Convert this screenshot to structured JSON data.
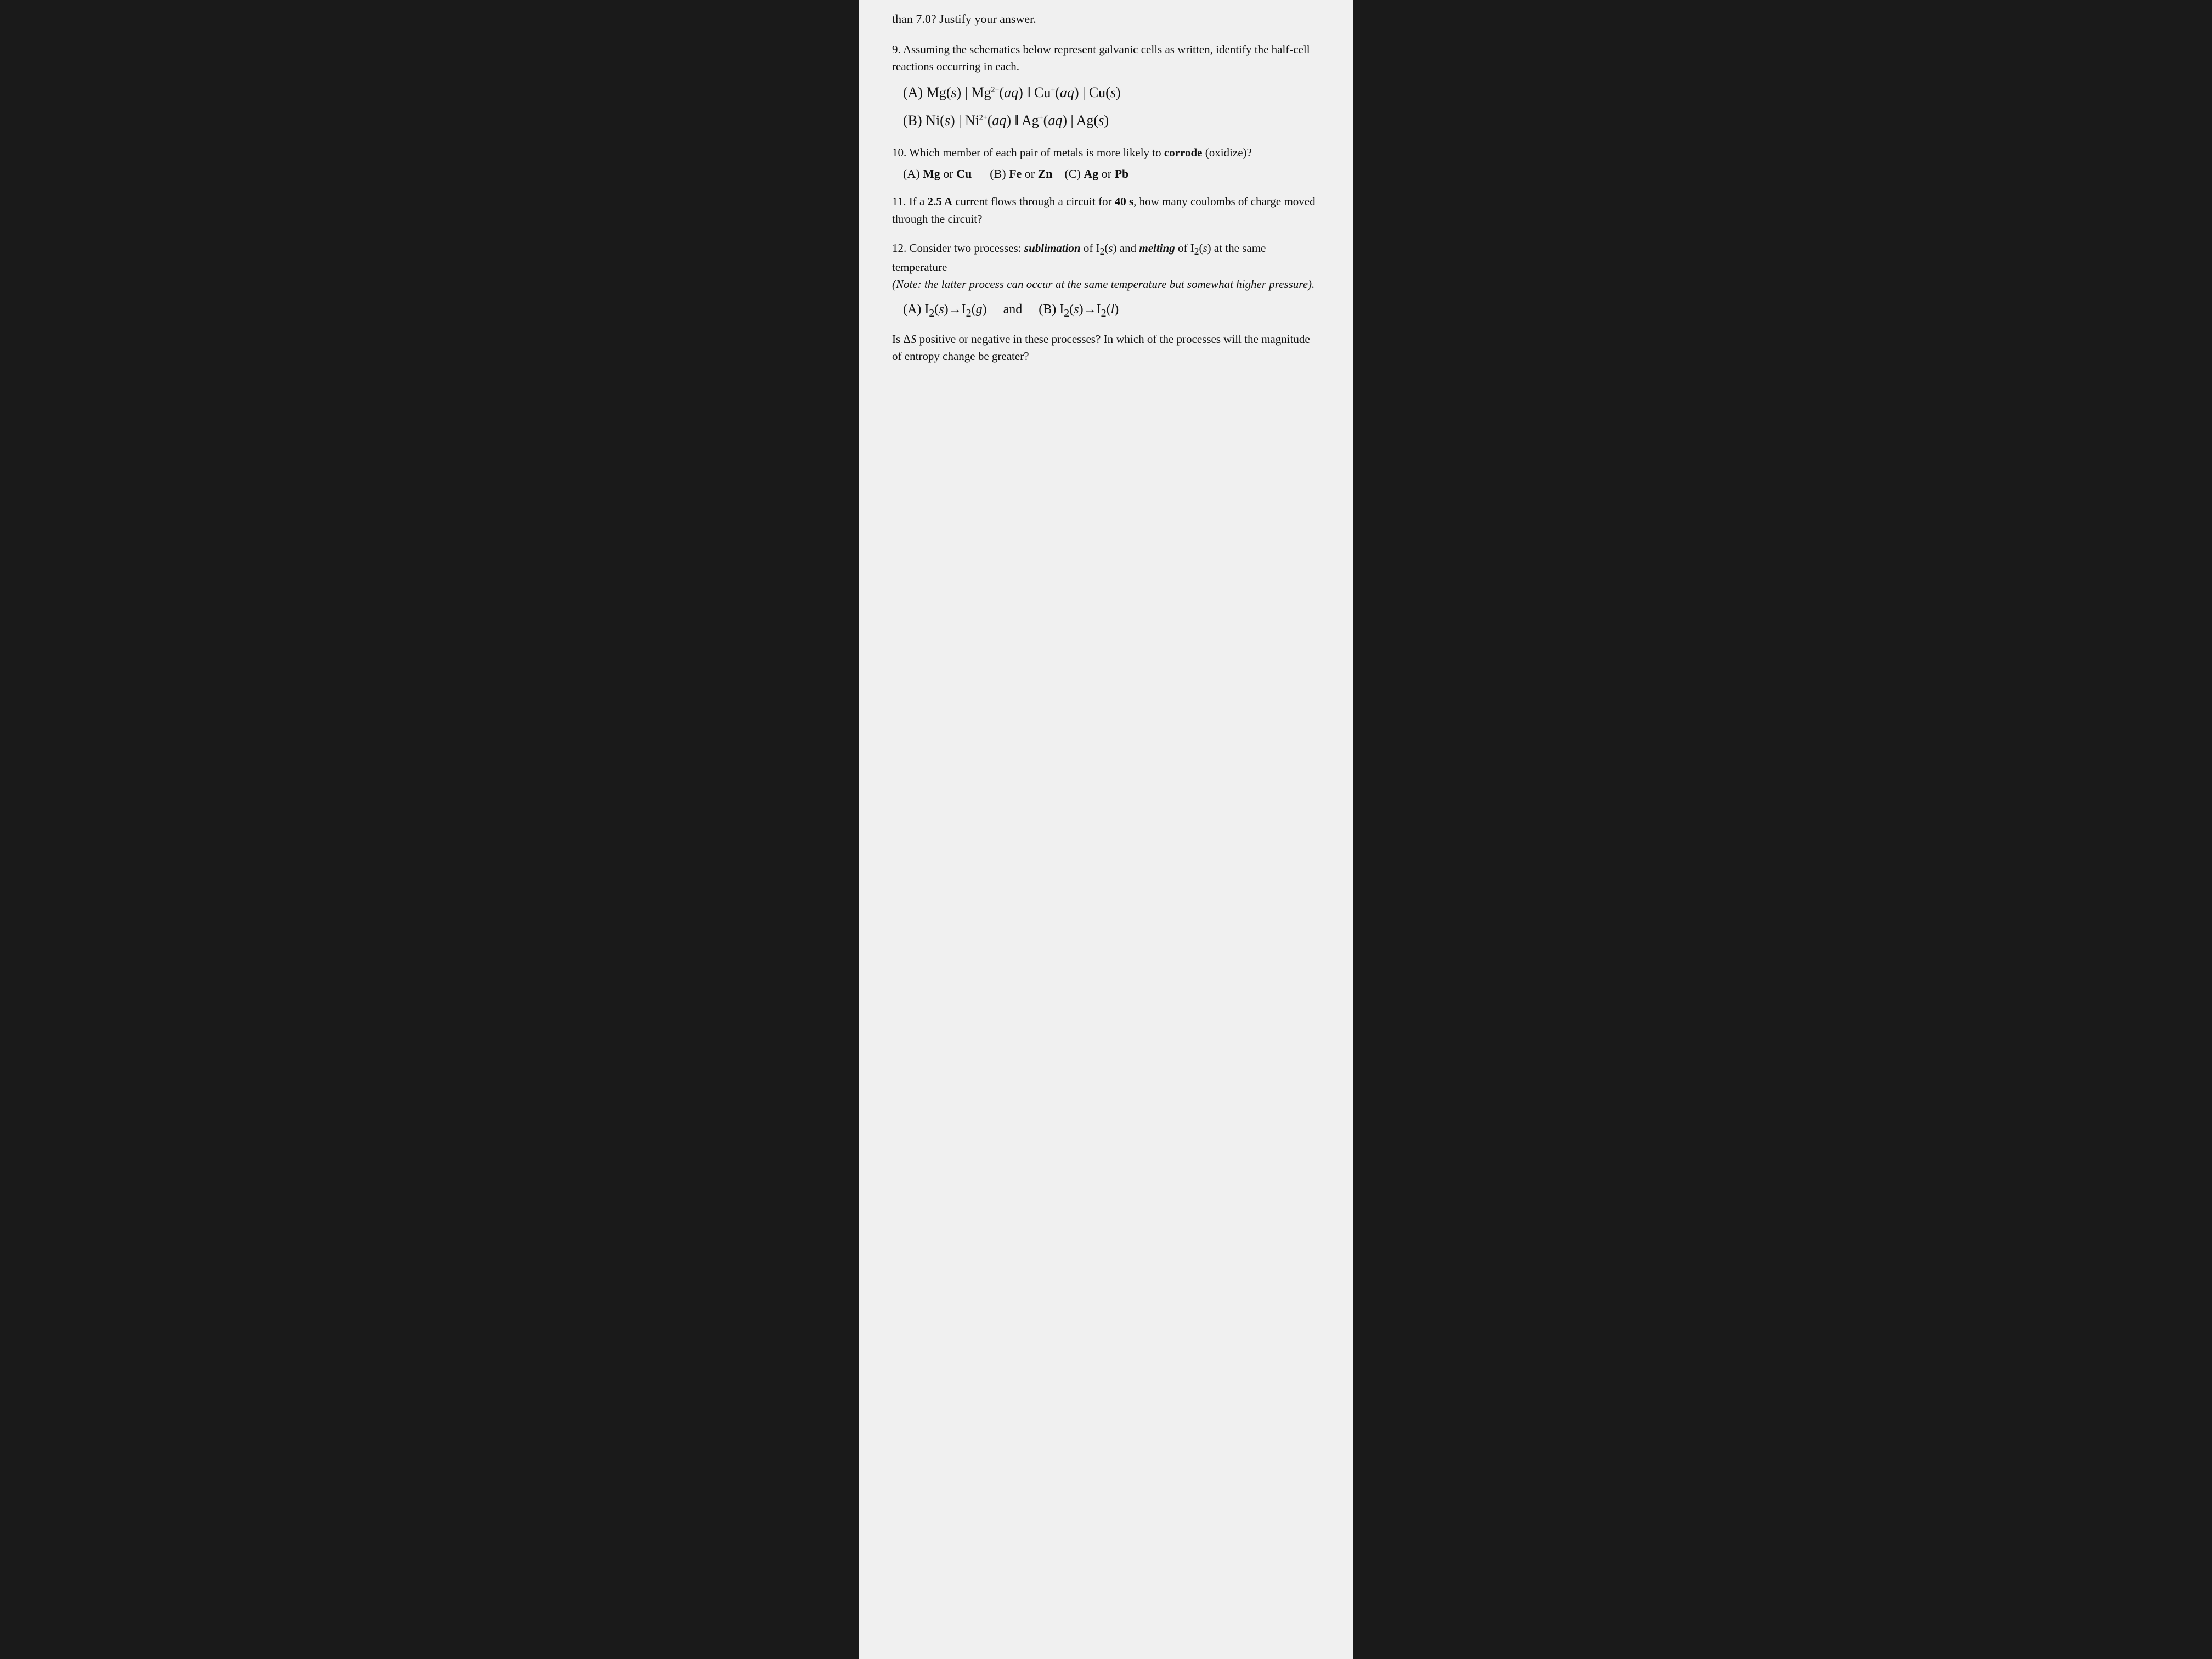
{
  "header": {
    "partial_text": "than 7.0? Justify your answer."
  },
  "questions": [
    {
      "id": "q9",
      "number": "9.",
      "text": "Assuming the schematics below represent galvanic cells as written, identify the half-cell reactions occurring in each.",
      "parts": [
        {
          "label": "(A)",
          "notation": "Mg(s) | Mg²⁺(aq) ‖ Cu⁺(aq) | Cu(s)"
        },
        {
          "label": "(B)",
          "notation": "Ni(s) | Ni²⁺(aq) ‖ Ag⁺(aq) | Ag(s)"
        }
      ]
    },
    {
      "id": "q10",
      "number": "10.",
      "text": "Which member of each pair of metals is more likely to corrode (oxidize)?",
      "options": "(A) Mg or Cu    (B) Fe or Zn   (C) Ag or Pb"
    },
    {
      "id": "q11",
      "number": "11.",
      "text": "If a 2.5 A current flows through a circuit for 40 s, how many coulombs of charge moved through the circuit?"
    },
    {
      "id": "q12",
      "number": "12.",
      "text_main": "Consider two processes: sublimation of I₂(s) and melting of I₂(s) at the same temperature",
      "text_note": "(Note: the latter process can occur at the same temperature but somewhat higher pressure).",
      "reactions": {
        "part_a": "(A)  I₂(s)→I₂(g)",
        "and_text": "and",
        "part_b": "(B)  I₂(s)→I₂(l)"
      },
      "bottom_text": "Is ΔS positive or negative in these processes? In which of the processes will the magnitude of entropy change be greater?"
    }
  ]
}
